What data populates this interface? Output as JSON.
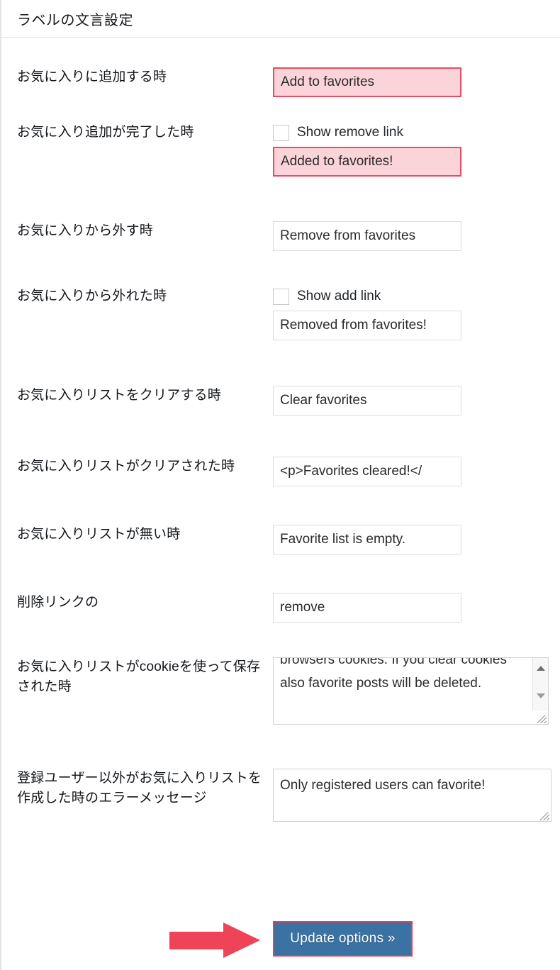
{
  "header": {
    "title": "ラベルの文言設定"
  },
  "rows": [
    {
      "label": "お気に入りに追加する時",
      "value": "Add to favorites",
      "highlight": true
    },
    {
      "label": "お気に入り追加が完了した時",
      "checkbox_label": "Show remove link",
      "checkbox_checked": false,
      "value": "Added to favorites!",
      "highlight": true
    },
    {
      "label": "お気に入りから外す時",
      "value": "Remove from favorites",
      "highlight": false
    },
    {
      "label": "お気に入りから外れた時",
      "checkbox_label": "Show add link",
      "checkbox_checked": false,
      "value": "Removed from favorites!",
      "highlight": false
    },
    {
      "label": "お気に入りリストをクリアする時",
      "value": "Clear favorites",
      "highlight": false
    },
    {
      "label": "お気に入りリストがクリアされた時",
      "value": "<p>Favorites cleared!</",
      "highlight": false
    },
    {
      "label": "お気に入りリストが無い時",
      "value": "Favorite list is empty.",
      "highlight": false
    },
    {
      "label": "削除リンクの",
      "value": "remove",
      "highlight": false
    },
    {
      "label": "お気に入りリストがcookieを使って保存された時",
      "value": "browsers cookies. If you clear cookies also favorite posts will be deleted.",
      "highlight": false
    },
    {
      "label": "登録ユーザー以外がお気に入りリストを作成した時のエラーメッセージ",
      "value": "Only registered users can favorite!",
      "highlight": false
    }
  ],
  "submit": {
    "label": "Update options »"
  },
  "colors": {
    "highlight_fill": "#fad4d8",
    "highlight_border": "#ec4a60",
    "arrow": "#ef4358",
    "button_fill": "#3a72a3",
    "button_border": "#ef3b55",
    "button_text": "#ffffff"
  }
}
